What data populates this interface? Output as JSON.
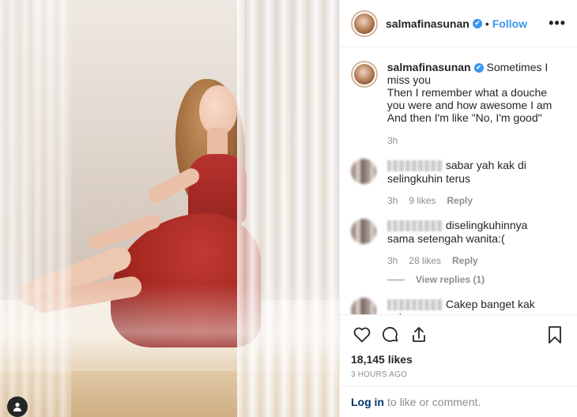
{
  "post": {
    "username": "salmafinasunan",
    "verified_mark": "✔",
    "separator": "•",
    "follow_label": "Follow",
    "more_label": "•••"
  },
  "caption": {
    "username": "salmafinasunan",
    "lines": [
      "Sometimes I miss you",
      "Then I remember what a douche you were and how awesome I am",
      "And then I'm like \"No, I'm good\""
    ],
    "time": "3h"
  },
  "comments": [
    {
      "text": "sabar yah kak di selingkuhin terus",
      "time": "3h",
      "likes": "9 likes",
      "reply": "Reply"
    },
    {
      "text": "diselingkuhinnya sama setengah wanita:(",
      "time": "3h",
      "likes": "28 likes",
      "reply": "Reply",
      "view_replies": "View replies (1)"
    },
    {
      "text": "Cakep banget kak salma"
    }
  ],
  "actions": {
    "likes": "18,145 likes",
    "posted": "3 HOURS AGO"
  },
  "login": {
    "link": "Log in",
    "rest": "to like or comment."
  },
  "colors": {
    "accent": "#3897f0",
    "dress": "#a3271f"
  },
  "icons": [
    "user-tag-icon",
    "verified-icon",
    "more-icon",
    "heart-icon",
    "comment-icon",
    "share-icon",
    "bookmark-icon"
  ]
}
